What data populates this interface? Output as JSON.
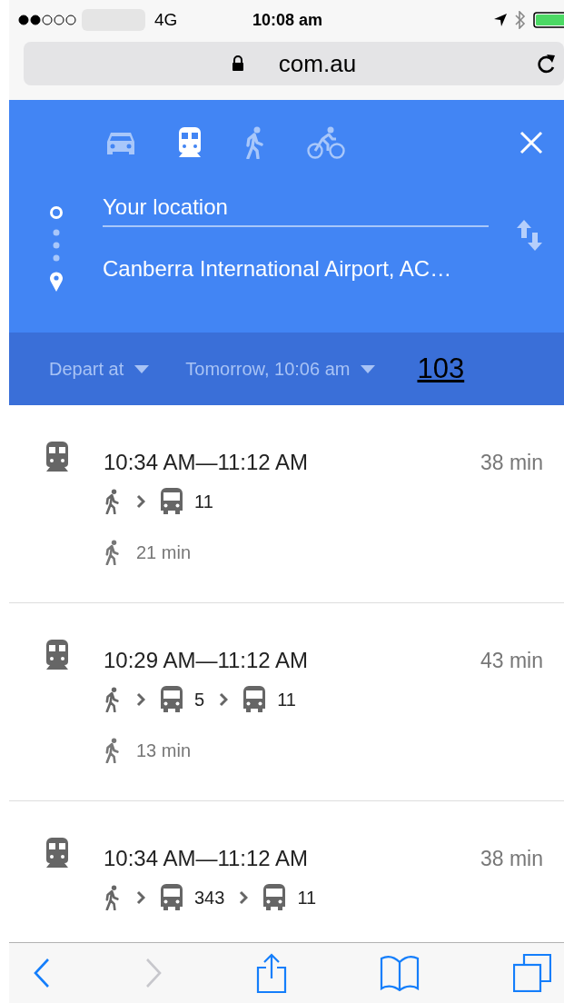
{
  "status_bar": {
    "network": "4G",
    "time": "10:08 am"
  },
  "address_bar": {
    "url": "com.au",
    "secure": true
  },
  "modes": [
    {
      "kind": "car",
      "selected": false
    },
    {
      "kind": "transit",
      "selected": true
    },
    {
      "kind": "walk",
      "selected": false
    },
    {
      "kind": "bike",
      "selected": false
    }
  ],
  "route": {
    "origin": "Your location",
    "destination": "Canberra International Airport, AC…"
  },
  "options": {
    "depart": "Depart at",
    "time": "Tomorrow, 10:06 am",
    "link": "103"
  },
  "results": [
    {
      "time_range": "10:34 AM—11:12 AM",
      "duration": "38 min",
      "steps": [
        {
          "kind": "walk"
        },
        {
          "kind": "bus",
          "label": "11"
        }
      ],
      "walk": "21 min"
    },
    {
      "time_range": "10:29 AM—11:12 AM",
      "duration": "43 min",
      "steps": [
        {
          "kind": "walk"
        },
        {
          "kind": "bus",
          "label": "5"
        },
        {
          "kind": "bus",
          "label": "11"
        }
      ],
      "walk": "13 min"
    },
    {
      "time_range": "10:34 AM—11:12 AM",
      "duration": "38 min",
      "steps": [
        {
          "kind": "walk"
        },
        {
          "kind": "bus",
          "label": "343"
        },
        {
          "kind": "bus",
          "label": "11"
        }
      ]
    }
  ],
  "toolbar": {
    "back_disabled": false,
    "forward_disabled": true
  }
}
